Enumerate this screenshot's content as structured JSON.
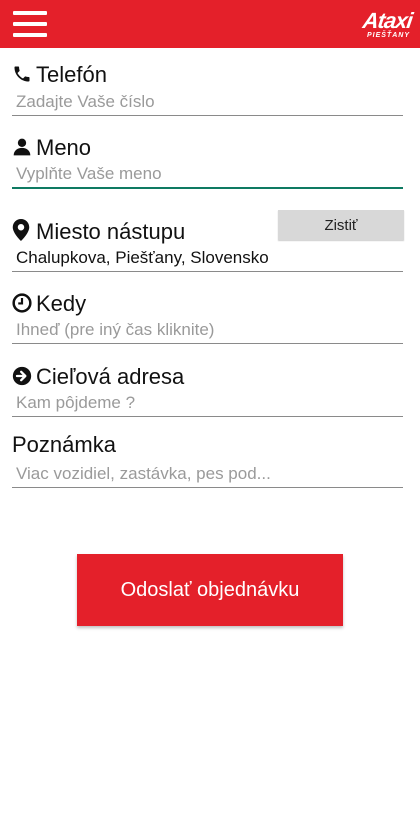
{
  "header": {
    "menu_icon": "hamburger-menu-icon",
    "logo_text": "Ataxi",
    "logo_subtext": "PIEŠŤANY",
    "background_color": "#e4202a"
  },
  "form": {
    "phone": {
      "label": "Telefón",
      "icon": "phone-icon",
      "placeholder": "Zadajte Vaše číslo",
      "value": ""
    },
    "name": {
      "label": "Meno",
      "icon": "user-icon",
      "placeholder": "Vyplňte Vaše meno",
      "value": "",
      "focused": true
    },
    "pickup": {
      "label": "Miesto nástupu",
      "icon": "map-marker-icon",
      "value": "Chalupkova, Piešťany, Slovensko",
      "detect_button_label": "Zistiť"
    },
    "when": {
      "label": "Kedy",
      "icon": "clock-icon",
      "placeholder": "Ihneď (pre iný čas kliknite)",
      "value": ""
    },
    "destination": {
      "label": "Cieľová adresa",
      "icon": "arrow-circle-right-icon",
      "placeholder": "Kam pôjdeme ?",
      "value": ""
    },
    "note": {
      "label": "Poznámka",
      "placeholder": "Viac vozidiel, zastávka, pes pod...",
      "value": ""
    }
  },
  "submit_button_label": "Odoslať objednávku",
  "colors": {
    "accent": "#e4202a",
    "focus_underline": "#0e7a62",
    "detect_button_bg": "#d8d8d8"
  }
}
